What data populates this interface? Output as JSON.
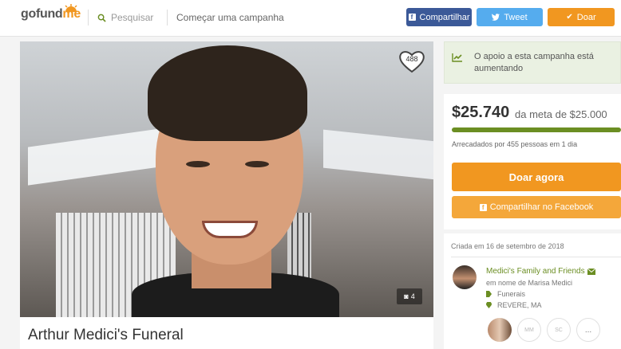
{
  "header": {
    "logo_go": "gofund",
    "logo_me": "me",
    "search_label": "Pesquisar",
    "start_label": "Começar uma campanha",
    "share_label": "Compartilhar",
    "tweet_label": "Tweet",
    "donate_label": "Doar"
  },
  "photo": {
    "heart_count": "488",
    "photo_count": "4"
  },
  "campaign": {
    "title": "Arthur Medici's Funeral"
  },
  "trend": {
    "text": "O apoio a esta campanha está aumentando"
  },
  "funding": {
    "amount": "$25.740",
    "goal": "da meta de $25.000",
    "progress": 1.0,
    "raised_text": "Arrecadados por 455 pessoas em 1 dia",
    "donate_now": "Doar agora",
    "share_facebook": "Compartilhar no Facebook"
  },
  "organizer": {
    "created": "Criada em 16 de setembro de 2018",
    "name": "Medici's Family and Friends",
    "on_behalf": "em nome de Marisa Medici",
    "category": "Funerais",
    "location": "REVERE, MA",
    "circles": [
      "MM",
      "SC",
      "..."
    ]
  },
  "colors": {
    "brand_orange": "#f19720",
    "facebook": "#3b5998",
    "twitter": "#55acee",
    "green": "#6b8e23"
  }
}
